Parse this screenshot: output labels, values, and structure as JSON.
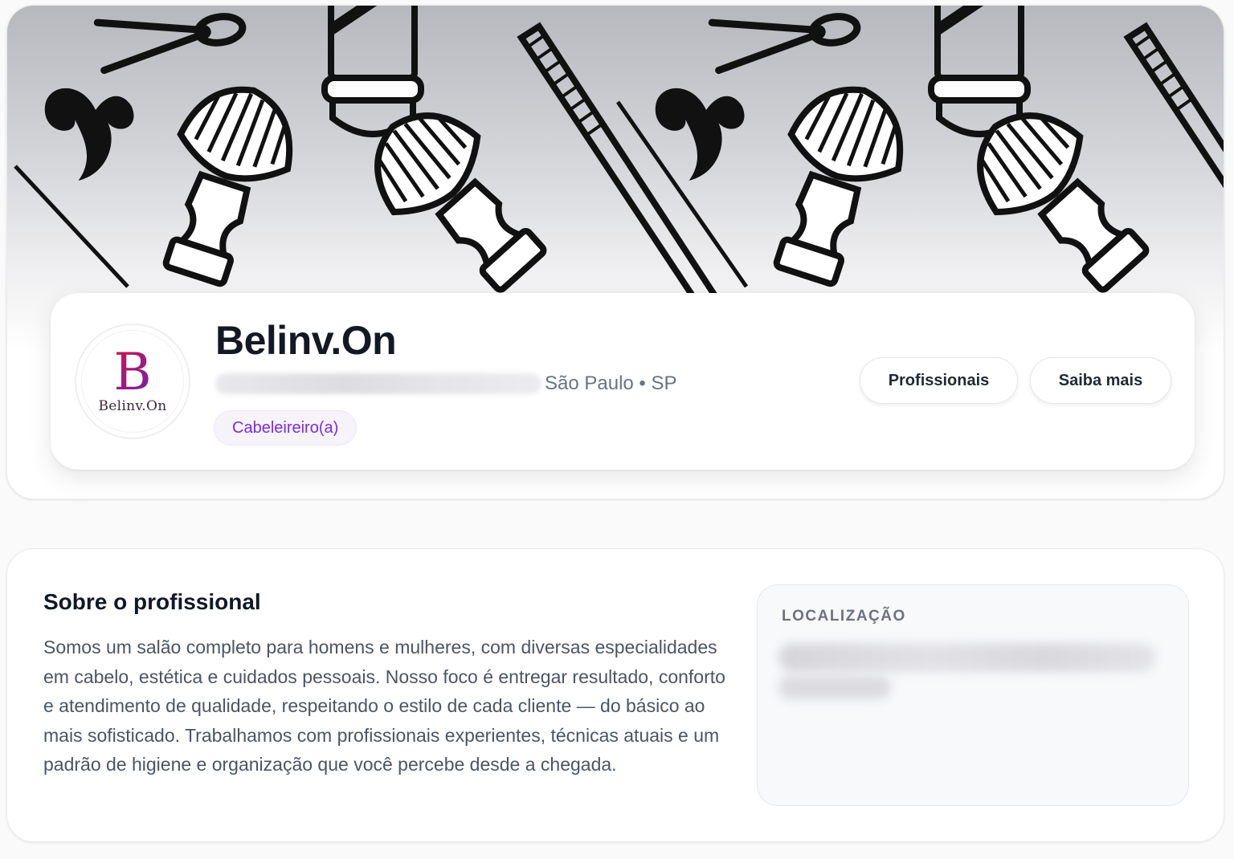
{
  "profile": {
    "name": "Belinv.On",
    "city": "São Paulo • SP",
    "category_tag": "Cabeleireiro(a)",
    "logo": {
      "letter": "B",
      "text": "Belinv.On"
    }
  },
  "actions": {
    "professionals_label": "Profissionais",
    "learn_more_label": "Saiba mais"
  },
  "about": {
    "title": "Sobre o profissional",
    "description": "Somos um salão completo para homens e mulheres, com diversas especialidades em cabelo, estética e cuidados pessoais. Nosso foco é entregar resultado, conforto e atendimento de qualidade, respeitando o estilo de cada cliente — do básico ao mais sofisticado. Trabalhamos com profissionais experientes, técnicas atuais e um padrão de higiene e organização que você percebe desde a chegada."
  },
  "location": {
    "label": "LOCALIZAÇÃO"
  },
  "colors": {
    "accent_purple": "#7c2ae8",
    "tag_background": "#f6f3fb",
    "logo_gradient": [
      "#c2185b",
      "#7b1fa2"
    ],
    "text_dark": "#141822",
    "text_muted": "#6b7280"
  },
  "icons": {
    "cover_pattern": [
      "scissors-icon",
      "comb-icon",
      "barber-pole-icon",
      "mustache-icon",
      "shaving-brush-icon"
    ]
  }
}
